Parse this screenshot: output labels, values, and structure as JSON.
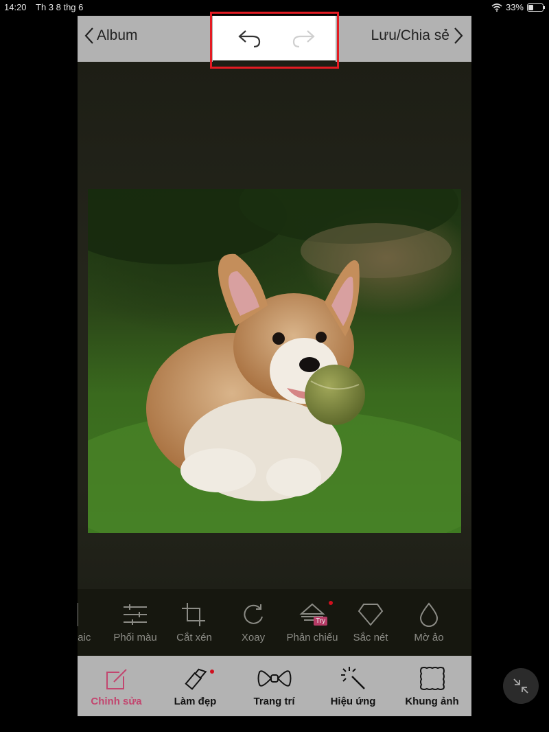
{
  "status_bar": {
    "time": "14:20",
    "date": "Th 3 8 thg 6",
    "battery": "33%",
    "battery_level": 0.33
  },
  "topbar": {
    "back_label": "Album",
    "save_label": "Lưu/Chia sẻ"
  },
  "tools": [
    {
      "label": "saic",
      "icon": "mosaic-icon"
    },
    {
      "label": "Phối màu",
      "icon": "sliders-icon"
    },
    {
      "label": "Cắt xén",
      "icon": "crop-icon"
    },
    {
      "label": "Xoay",
      "icon": "rotate-icon"
    },
    {
      "label": "Phản chiếu",
      "icon": "mirror-icon",
      "badge": "Try"
    },
    {
      "label": "Sắc nét",
      "icon": "diamond-icon"
    },
    {
      "label": "Mờ ảo",
      "icon": "drop-icon"
    }
  ],
  "tabs": [
    {
      "label": "Chỉnh sửa",
      "icon": "edit-icon",
      "active": true
    },
    {
      "label": "Làm đẹp",
      "icon": "lipstick-icon"
    },
    {
      "label": "Trang trí",
      "icon": "bow-icon"
    },
    {
      "label": "Hiệu ứng",
      "icon": "magic-wand-icon"
    },
    {
      "label": "Khung ảnh",
      "icon": "frame-icon"
    }
  ],
  "colors": {
    "accent": "#c2466f",
    "highlight": "#e31b23",
    "bar": "#b3b3b3"
  }
}
